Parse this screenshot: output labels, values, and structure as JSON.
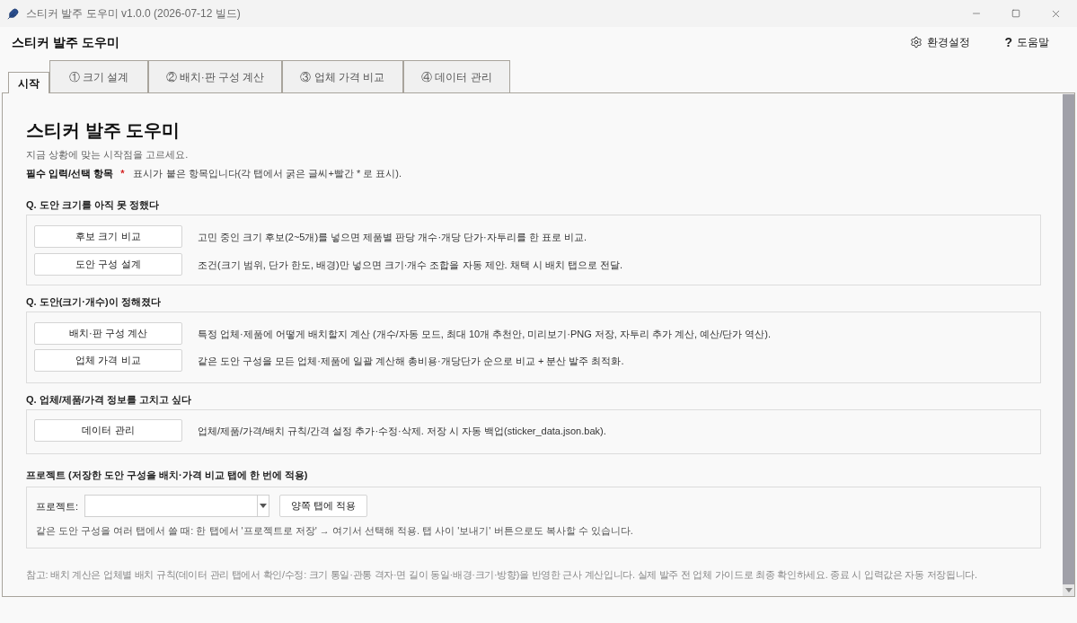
{
  "window": {
    "title": "스티커 발주 도우미 v1.0.0 (2026-07-12 빌드)"
  },
  "header": {
    "title": "스티커 발주 도우미",
    "actions": [
      {
        "kind": "settings",
        "label": "환경설정"
      },
      {
        "kind": "help",
        "icon": "?",
        "label": "도움말"
      }
    ]
  },
  "tabs": [
    {
      "label": "시작",
      "selected": true
    },
    {
      "label": "① 크기 설계",
      "selected": false
    },
    {
      "label": "② 배치·판 구성 계산",
      "selected": false
    },
    {
      "label": "③ 업체 가격 비교",
      "selected": false
    },
    {
      "label": "④ 데이터 관리",
      "selected": false
    }
  ],
  "page": {
    "title": "스티커 발주 도우미",
    "subtitle": "지금 상황에 맞는 시작점을 고르세요.",
    "required_note": {
      "label": "필수 입력/선택 항목",
      "mark": "*",
      "text": "표시가 붙은 항목입니다(각 탭에서 굵은 글씨+빨간 * 로 표시)."
    }
  },
  "sections": [
    {
      "heading": "Q. 도안 크기를 아직 못 정했다",
      "rows": [
        {
          "button": "후보 크기 비교",
          "description": "고민 중인 크기 후보(2~5개)를 넣으면 제품별 판당 개수·개당 단가·자투리를 한 표로 비교."
        },
        {
          "button": "도안 구성 설계",
          "description": "조건(크기 범위, 단가 한도, 배경)만 넣으면 크기·개수 조합을 자동 제안. 채택 시 배치 탭으로 전달."
        }
      ]
    },
    {
      "heading": "Q. 도안(크기·개수)이 정해졌다",
      "rows": [
        {
          "button": "배치·판 구성 계산",
          "description": "특정 업체·제품에 어떻게 배치할지 계산 (개수/자동 모드, 최대 10개 추천안, 미리보기·PNG 저장, 자투리 추가 계산, 예산/단가 역산)."
        },
        {
          "button": "업체 가격 비교",
          "description": "같은 도안 구성을 모든 업체·제품에 일괄 계산해 총비용·개당단가 순으로 비교 + 분산 발주 최적화."
        }
      ]
    },
    {
      "heading": "Q. 업체/제품/가격 정보를 고치고 싶다",
      "rows": [
        {
          "button": "데이터 관리",
          "description": "업체/제품/가격/배치 규칙/간격 설정 추가·수정·삭제. 저장 시 자동 백업(sticker_data.json.bak)."
        }
      ]
    }
  ],
  "project": {
    "heading": "프로젝트 (저장한 도안 구성을 배치·가격 비교 탭에 한 번에 적용)",
    "label": "프로젝트:",
    "button": "양쪽 탭에 적용",
    "hint": "같은 도안 구성을 여러 탭에서 쓸 때: 한 탭에서 '프로젝트로 저장' → 여기서 선택해 적용. 탭 사이 '보내기' 버튼으로도 복사할 수 있습니다."
  },
  "note": "참고: 배치 계산은 업체별 배치 규칙(데이터 관리 탭에서 확인/수정: 크기 통일·관통 격자·면 길이 동일·배경·크기·방향)을 반영한 근사 계산입니다. 실제 발주 전 업체 가이드로 최종 확인하세요. 종료 시 입력값은 자동 저장됩니다."
}
